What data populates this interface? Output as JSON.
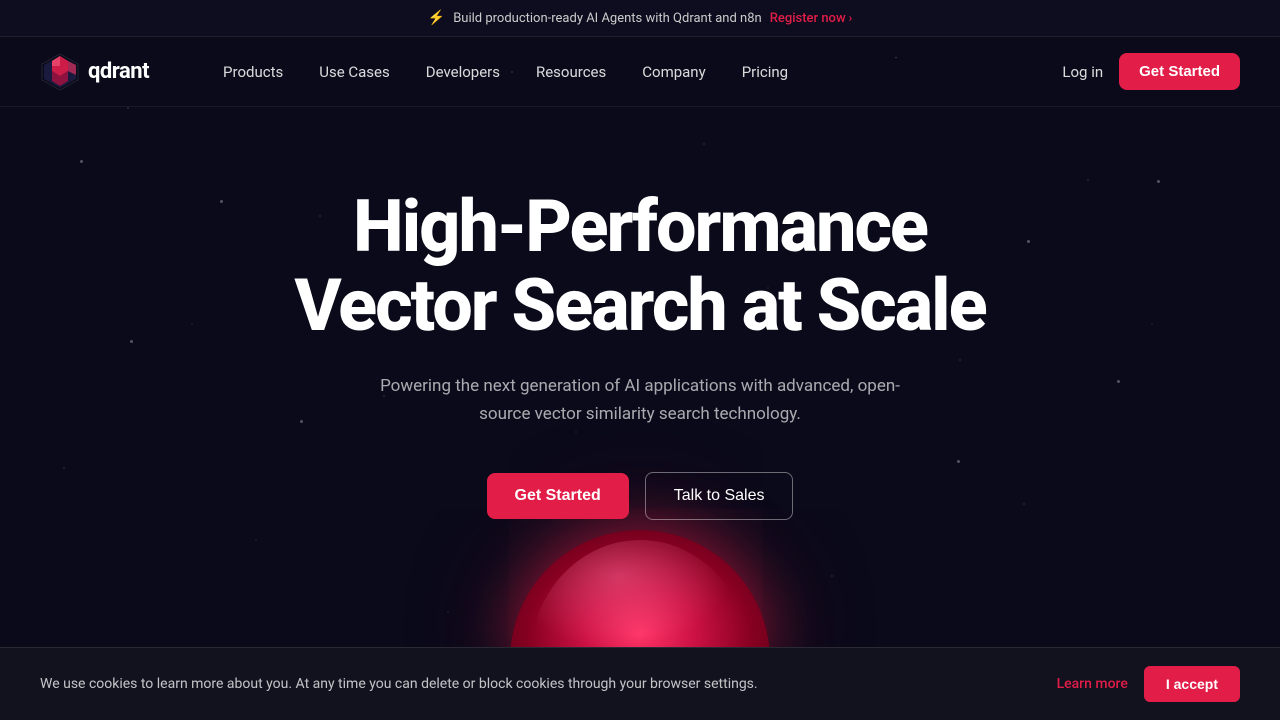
{
  "announcement": {
    "lightning_icon": "⚡",
    "text": "Build production-ready AI Agents with Qdrant and n8n",
    "register_label": "Register now",
    "arrow": "›"
  },
  "navbar": {
    "logo_text": "qdrant",
    "nav_items": [
      {
        "label": "Products",
        "id": "products"
      },
      {
        "label": "Use Cases",
        "id": "use-cases"
      },
      {
        "label": "Developers",
        "id": "developers"
      },
      {
        "label": "Resources",
        "id": "resources"
      },
      {
        "label": "Company",
        "id": "company"
      },
      {
        "label": "Pricing",
        "id": "pricing"
      }
    ],
    "login_label": "Log in",
    "get_started_label": "Get Started"
  },
  "hero": {
    "title": "High-Performance Vector Search at Scale",
    "subtitle": "Powering the next generation of AI applications with advanced, open-source vector similarity search technology.",
    "get_started_label": "Get Started",
    "talk_to_sales_label": "Talk to Sales"
  },
  "cookie": {
    "text": "We use cookies to learn more about you. At any time you can delete or block cookies through your browser settings.",
    "learn_more_label": "Learn more",
    "accept_label": "I accept"
  }
}
